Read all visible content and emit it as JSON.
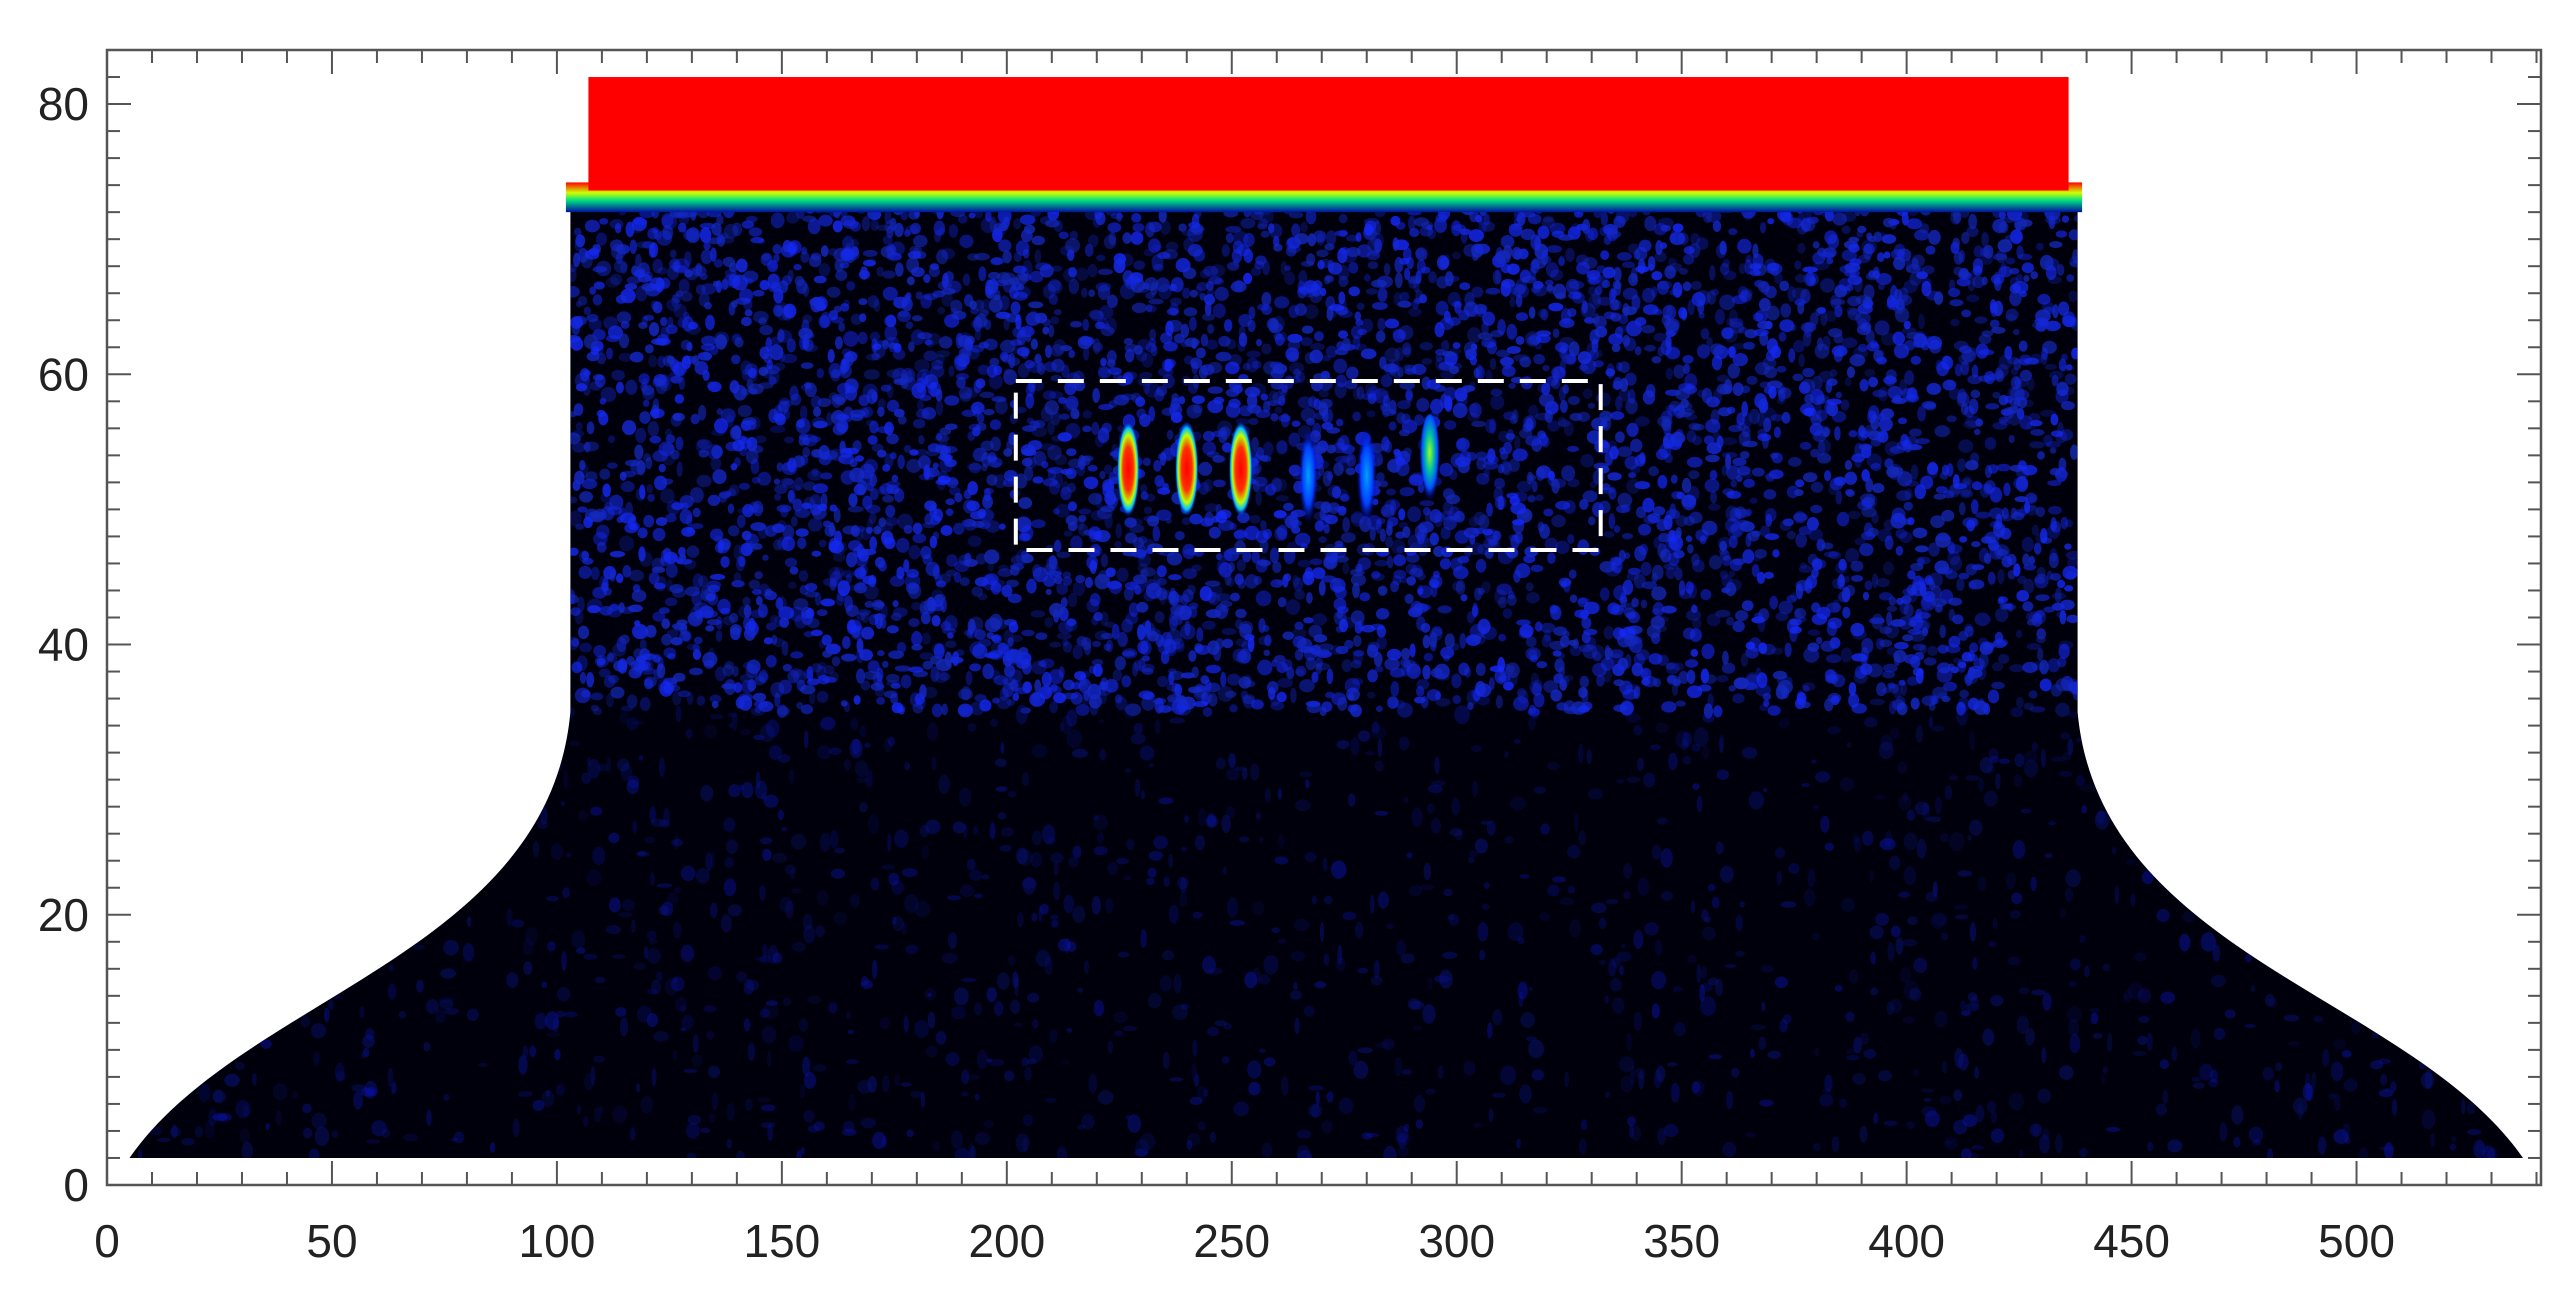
{
  "chart_data": {
    "type": "heatmap",
    "title": "",
    "xlabel": "",
    "ylabel": "",
    "xlim": [
      0,
      541
    ],
    "ylim": [
      0,
      84
    ],
    "x_ticks": [
      0,
      50,
      100,
      150,
      200,
      250,
      300,
      350,
      400,
      450,
      500
    ],
    "y_ticks": [
      0,
      20,
      40,
      60,
      80
    ],
    "x_tick_labels": [
      "0",
      "50",
      "100",
      "150",
      "200",
      "250",
      "300",
      "350",
      "400",
      "450",
      "500"
    ],
    "y_tick_labels": [
      "0",
      "20",
      "40",
      "60",
      "80"
    ],
    "colormap": [
      "#000010",
      "#0000c0",
      "#0060ff",
      "#00e0a0",
      "#c0ff00",
      "#ff0000"
    ],
    "regions": {
      "fan_bottom_x": [
        5,
        537
      ],
      "fan_top_x": [
        103,
        438
      ],
      "fan_bottom_y": 2,
      "fan_transition_y": 35,
      "speckle_top_y": 73,
      "saturated_band": {
        "x": [
          107,
          436
        ],
        "y": [
          73,
          82
        ],
        "color": "#ff0000"
      }
    },
    "annotation_box": {
      "x": [
        202,
        332
      ],
      "y": [
        47,
        59.5
      ],
      "style": "dashed",
      "color": "#ffffff"
    },
    "targets": [
      {
        "x": 227,
        "y": 53,
        "intensity": 0.85
      },
      {
        "x": 240,
        "y": 53,
        "intensity": 0.95
      },
      {
        "x": 252,
        "y": 53,
        "intensity": 1.0
      },
      {
        "x": 267,
        "y": 52.5,
        "intensity": 0.35
      },
      {
        "x": 280,
        "y": 52.5,
        "intensity": 0.45
      },
      {
        "x": 294,
        "y": 53.5,
        "intensity": 0.6
      }
    ]
  }
}
